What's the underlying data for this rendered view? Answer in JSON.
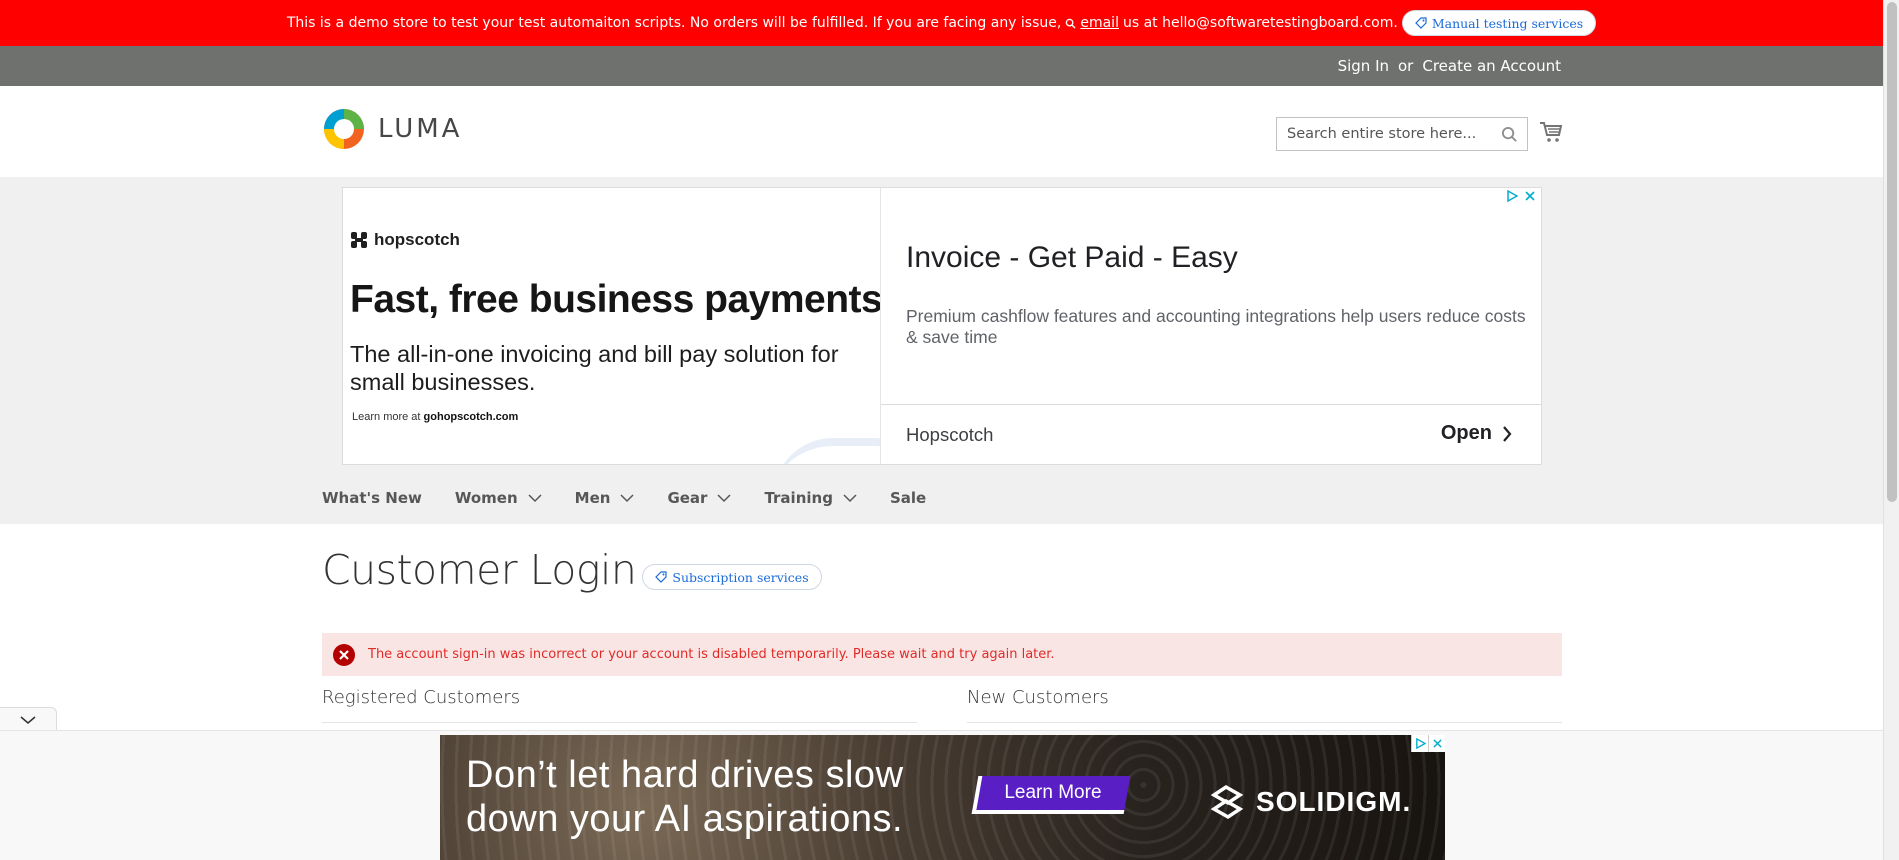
{
  "demo_banner": {
    "text_before": "This is a demo store to test your test automaiton scripts. No orders will be fulfilled. If you are facing any issue,",
    "email_link": "email",
    "text_after": "us at hello@softwaretestingboard.com.",
    "pill_label": "Manual testing services"
  },
  "header": {
    "sign_in": "Sign In",
    "or": "or",
    "create_account": "Create an Account"
  },
  "logo": {
    "text": "LUMA"
  },
  "search": {
    "placeholder": "Search entire store here..."
  },
  "ad": {
    "left": {
      "brand": "hopscotch",
      "headline": "Fast, free business payments",
      "subhead": "The all-in-one invoicing and bill pay solution for small businesses.",
      "learn_prefix": "Learn more at ",
      "learn_url": "gohopscotch.com"
    },
    "right": {
      "title": "Invoice - Get Paid - Easy",
      "description": "Premium cashflow features and accounting integrations help users reduce costs & save time",
      "advertiser": "Hopscotch",
      "open_label": "Open"
    }
  },
  "nav": {
    "items": [
      {
        "label": "What's New"
      },
      {
        "label": "Women"
      },
      {
        "label": "Men"
      },
      {
        "label": "Gear"
      },
      {
        "label": "Training"
      },
      {
        "label": "Sale"
      }
    ]
  },
  "main": {
    "page_title": "Customer Login",
    "title_pill": "Subscription services",
    "error_message": "The account sign-in was incorrect or your account is disabled temporarily. Please wait and try again later.",
    "registered_title": "Registered Customers",
    "new_title": "New Customers"
  },
  "banner_ad": {
    "line1": "Don’t let hard drives slow",
    "line2": "down your AI aspirations.",
    "cta": "Learn More",
    "brand": "SOLIDIGM."
  },
  "colors": {
    "demo_banner_bg": "#ff0000",
    "header_panel_bg": "#6e716e",
    "error_text": "#e02b27",
    "error_bg": "#fae5e5"
  }
}
